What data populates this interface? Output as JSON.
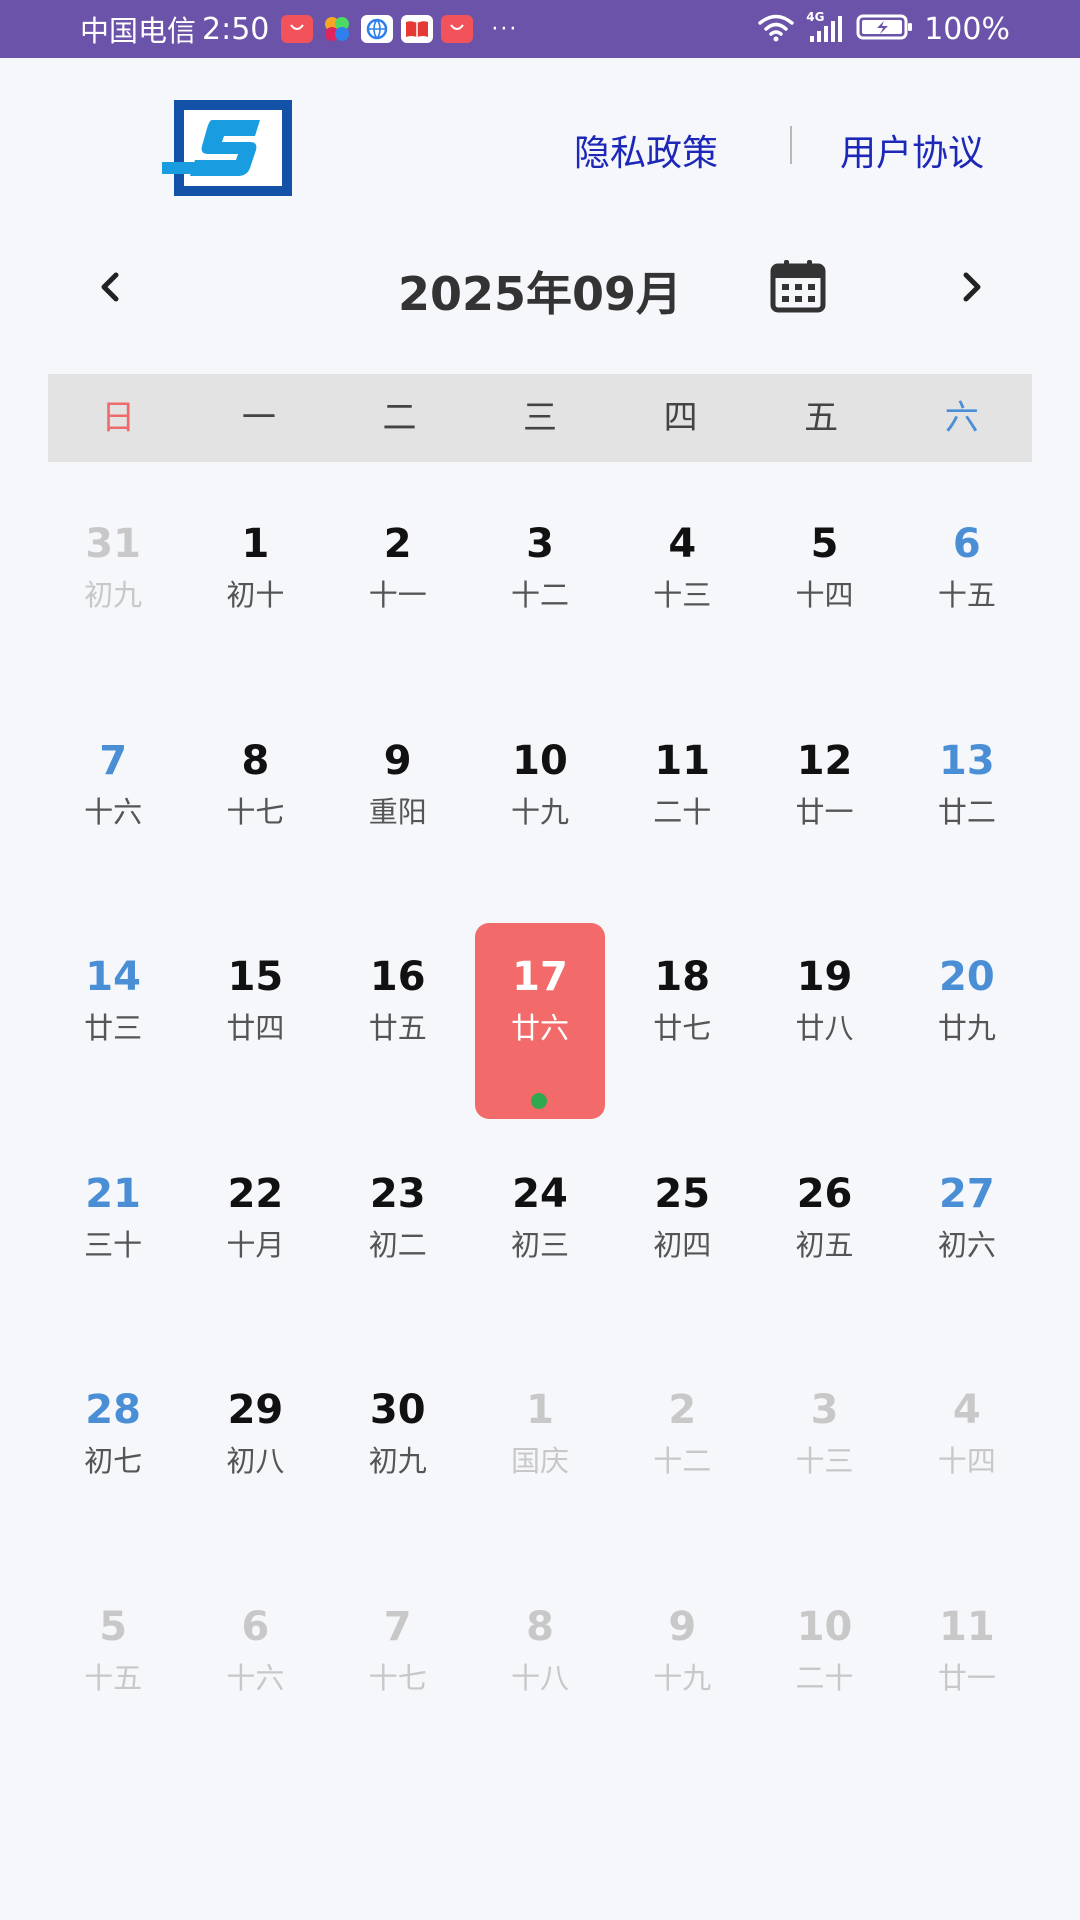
{
  "status_bar": {
    "carrier": "中国电信",
    "time": "2:50",
    "dots": "···",
    "network": "4G",
    "battery": "100%",
    "app_icons": [
      {
        "name": "huawei-appgallery-icon",
        "color": "#f2535b",
        "label": "HUAWEI"
      },
      {
        "name": "multicolor-app-icon",
        "color": "#6a53a8",
        "label": ""
      },
      {
        "name": "browser-icon",
        "color": "#ffffff",
        "label": ""
      },
      {
        "name": "book-icon",
        "color": "#ffffff",
        "label": ""
      },
      {
        "name": "huawei-store-icon",
        "color": "#f2535b",
        "label": "HUAWEI"
      }
    ]
  },
  "header": {
    "logo_icon": "logo-s-icon",
    "privacy_link": "隐私政策",
    "terms_link": "用户协议"
  },
  "month_nav": {
    "title": "2025年09月",
    "prev_icon": "chevron-left-icon",
    "next_icon": "chevron-right-icon",
    "calendar_icon": "calendar-icon"
  },
  "weekdays": [
    "日",
    "一",
    "二",
    "三",
    "四",
    "五",
    "六"
  ],
  "colors": {
    "status_bar": "#6a53a8",
    "link": "#1d28b8",
    "sunday": "#ef6b6b",
    "saturday_weekend": "#4a8fd6",
    "selected_bg": "#f26a6a",
    "event_dot": "#2fa84f",
    "muted": "#c8c8c8"
  },
  "weeks": [
    [
      {
        "day": "31",
        "lunar": "初九",
        "state": "other"
      },
      {
        "day": "1",
        "lunar": "初十",
        "state": "normal"
      },
      {
        "day": "2",
        "lunar": "十一",
        "state": "normal"
      },
      {
        "day": "3",
        "lunar": "十二",
        "state": "normal"
      },
      {
        "day": "4",
        "lunar": "十三",
        "state": "normal"
      },
      {
        "day": "5",
        "lunar": "十四",
        "state": "normal"
      },
      {
        "day": "6",
        "lunar": "十五",
        "state": "weekend"
      }
    ],
    [
      {
        "day": "7",
        "lunar": "十六",
        "state": "weekend"
      },
      {
        "day": "8",
        "lunar": "十七",
        "state": "normal"
      },
      {
        "day": "9",
        "lunar": "重阳",
        "state": "normal"
      },
      {
        "day": "10",
        "lunar": "十九",
        "state": "normal"
      },
      {
        "day": "11",
        "lunar": "二十",
        "state": "normal"
      },
      {
        "day": "12",
        "lunar": "廿一",
        "state": "normal"
      },
      {
        "day": "13",
        "lunar": "廿二",
        "state": "weekend"
      }
    ],
    [
      {
        "day": "14",
        "lunar": "廿三",
        "state": "weekend"
      },
      {
        "day": "15",
        "lunar": "廿四",
        "state": "normal"
      },
      {
        "day": "16",
        "lunar": "廿五",
        "state": "normal"
      },
      {
        "day": "17",
        "lunar": "廿六",
        "state": "selected",
        "event": true
      },
      {
        "day": "18",
        "lunar": "廿七",
        "state": "normal"
      },
      {
        "day": "19",
        "lunar": "廿八",
        "state": "normal"
      },
      {
        "day": "20",
        "lunar": "廿九",
        "state": "weekend"
      }
    ],
    [
      {
        "day": "21",
        "lunar": "三十",
        "state": "weekend"
      },
      {
        "day": "22",
        "lunar": "十月",
        "state": "normal"
      },
      {
        "day": "23",
        "lunar": "初二",
        "state": "normal"
      },
      {
        "day": "24",
        "lunar": "初三",
        "state": "normal"
      },
      {
        "day": "25",
        "lunar": "初四",
        "state": "normal"
      },
      {
        "day": "26",
        "lunar": "初五",
        "state": "normal"
      },
      {
        "day": "27",
        "lunar": "初六",
        "state": "weekend"
      }
    ],
    [
      {
        "day": "28",
        "lunar": "初七",
        "state": "weekend"
      },
      {
        "day": "29",
        "lunar": "初八",
        "state": "normal"
      },
      {
        "day": "30",
        "lunar": "初九",
        "state": "normal"
      },
      {
        "day": "1",
        "lunar": "国庆",
        "state": "other"
      },
      {
        "day": "2",
        "lunar": "十二",
        "state": "other"
      },
      {
        "day": "3",
        "lunar": "十三",
        "state": "other"
      },
      {
        "day": "4",
        "lunar": "十四",
        "state": "other"
      }
    ],
    [
      {
        "day": "5",
        "lunar": "十五",
        "state": "other"
      },
      {
        "day": "6",
        "lunar": "十六",
        "state": "other"
      },
      {
        "day": "7",
        "lunar": "十七",
        "state": "other"
      },
      {
        "day": "8",
        "lunar": "十八",
        "state": "other"
      },
      {
        "day": "9",
        "lunar": "十九",
        "state": "other"
      },
      {
        "day": "10",
        "lunar": "二十",
        "state": "other"
      },
      {
        "day": "11",
        "lunar": "廿一",
        "state": "other"
      }
    ]
  ]
}
